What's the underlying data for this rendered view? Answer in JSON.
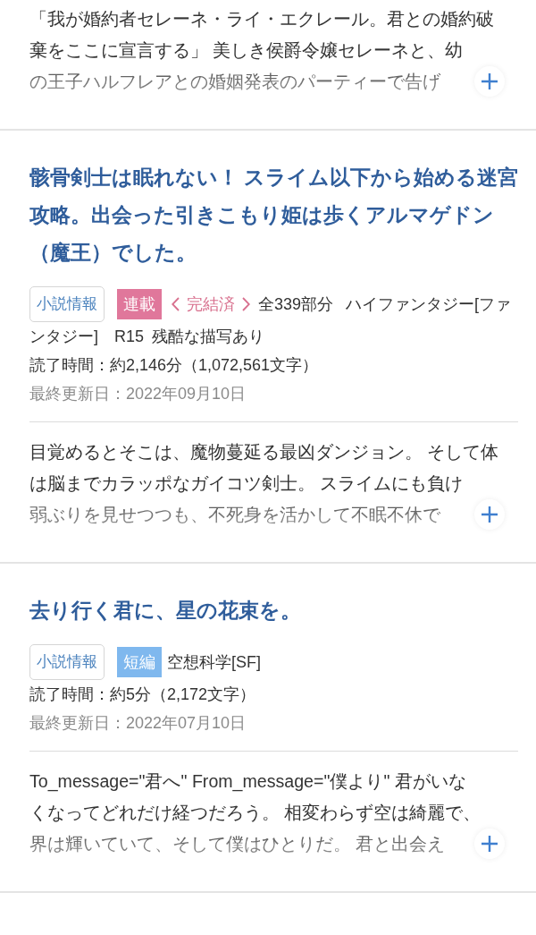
{
  "works": [
    {
      "synopsis": {
        "lines": [
          "「我が婚約者セレーネ・ライ・エクレール。君との婚約破",
          "棄をここに宣言する」 美しき侯爵令嬢セレーネと、幼",
          "の王子ハルフレアとの婚姻発表のパーティーで告げ"
        ],
        "expanded": false
      }
    },
    {
      "title": "骸骨剣士は眠れない！ スライム以下から始める迷宮攻略。出会った引きこもり姫は歩くアルマゲドン（魔王）でした。",
      "info_button": "小説情報",
      "type_tag": {
        "label": "連載",
        "color": "#e0779b"
      },
      "status": "完結済",
      "episodes": "全339部分",
      "genre": [
        "ハイファンタジー[ファ",
        "ンタジー]"
      ],
      "rating": "R15",
      "warning": "残酷な描写あり",
      "read_time": "読了時間：約2,146分（1,072,561文字）",
      "updated": "最終更新日：2022年09月10日",
      "synopsis": {
        "lines": [
          "目覚めるとそこは、魔物蔓延る最凶ダンジョン。 そして体",
          "は脳までカラッポなガイコツ剣士。 スライムにも負け",
          "弱ぶりを見せつつも、不死身を活かして不眠不休で"
        ],
        "expanded": false
      }
    },
    {
      "title": "去り行く君に、星の花束を。",
      "info_button": "小説情報",
      "type_tag": {
        "label": "短編",
        "color": "#7fb8ee"
      },
      "genre": [
        "空想科学[SF]"
      ],
      "read_time": "読了時間：約5分（2,172文字）",
      "updated": "最終更新日：2022年07月10日",
      "synopsis": {
        "lines": [
          "To_message=\"君へ\" From_message=\"僕より\" 君がいな",
          "くなってどれだけ経つだろう。 相変わらず空は綺麗で、",
          "界は輝いていて、そして僕はひとりだ。 君と出会え"
        ],
        "expanded": false
      }
    }
  ]
}
